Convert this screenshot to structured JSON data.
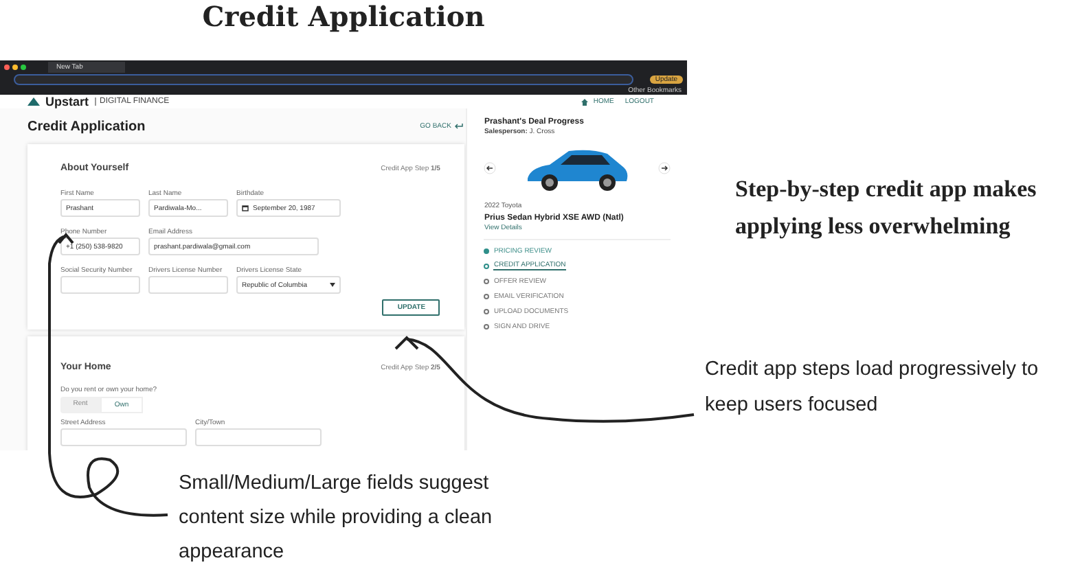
{
  "title": "Credit Application",
  "browser": {
    "tab_title": "New Tab",
    "update_button": "Update",
    "bookmarks": "Other Bookmarks"
  },
  "nav": {
    "logo": "Upstart",
    "subtitle": "DIGITAL FINANCE",
    "links": [
      "HOME",
      "LOGOUT"
    ]
  },
  "page_title": "Credit Application",
  "go_back": "GO BACK",
  "about": {
    "heading": "About Yourself",
    "step": "Credit App Step **1/5**",
    "fields": [
      {
        "label": "First Name",
        "value": "Prashant",
        "kind": "text"
      },
      {
        "label": "Last Name",
        "value": "Pardiwala-Mo...",
        "kind": "text"
      },
      {
        "label": "Birthdate",
        "value": "September 20, 1987",
        "kind": "date"
      },
      {
        "label": "Phone Number",
        "value": "+1 (250) 538-9820",
        "kind": "text"
      },
      {
        "label": "Email Address",
        "value": "prashant.pardiwala@gmail.com",
        "kind": "text"
      },
      {
        "label": "Social Security Number",
        "kind": "text"
      },
      {
        "label": "Drivers License Number",
        "kind": "text"
      },
      {
        "label": "Drivers License State",
        "value": "Republic of Columbia",
        "kind": "select"
      }
    ],
    "button": "UPDATE"
  },
  "home": {
    "heading": "Your Home",
    "step": "Credit App Step **2/5**",
    "question": "Do you rent or own your home?",
    "options": [
      {
        "label": "Rent",
        "selected": false
      },
      {
        "label": "Own",
        "selected": true
      }
    ],
    "fields": [
      {
        "label": "Street Address"
      },
      {
        "label": "City/Town"
      }
    ]
  },
  "deal": {
    "heading": "Prashant's Deal Progress",
    "salesperson": "**Salesperson:** J. Cross",
    "make": "2022 Toyota",
    "model": "Prius Sedan Hybrid XSE AWD (Natl)",
    "details_link": "View Details",
    "steps": [
      {
        "label": "PRICING REVIEW",
        "completed": true,
        "selected": false
      },
      {
        "label": "CREDIT APPLICATION",
        "completed": false,
        "selected": true
      },
      {
        "label": "OFFER REVIEW",
        "completed": false,
        "selected": false
      },
      {
        "label": "EMAIL VERIFICATION",
        "completed": false,
        "selected": false
      },
      {
        "label": "UPLOAD DOCUMENTS",
        "completed": false,
        "selected": false
      },
      {
        "label": "SIGN AND DRIVE",
        "completed": false,
        "selected": false
      }
    ]
  },
  "annotations": {
    "steps_note": "Step-by-step credit app makes applying less overwhelming",
    "progress_note": "Credit app steps load progressively to keep users focused",
    "fields_note": "Small/Medium/Large fields suggest content size while providing a clean appearance"
  }
}
